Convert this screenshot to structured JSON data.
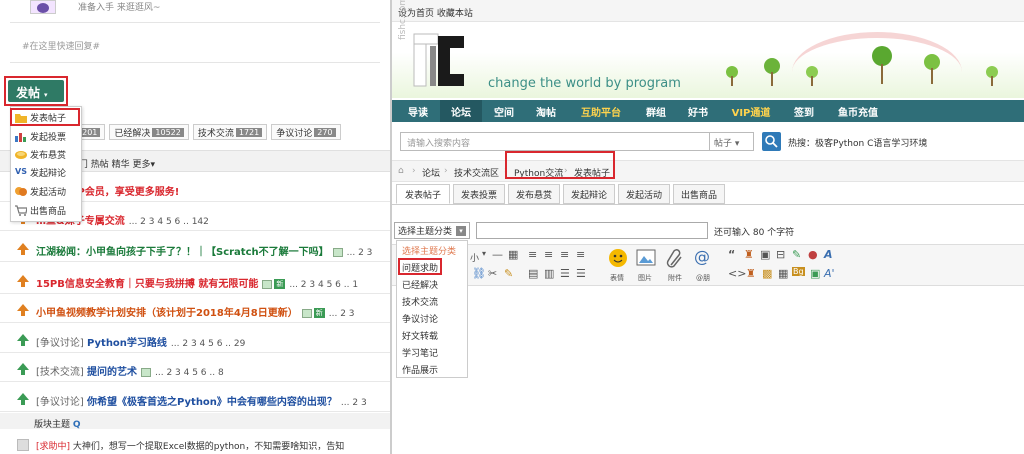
{
  "left": {
    "top_line": "准备入手 来逛逛风~",
    "quick_reply_placeholder": "#在这里快速回复#",
    "post_button": {
      "label": "发帖",
      "caret": "▾"
    },
    "dropdown": [
      {
        "label": "发表帖子",
        "icon": "folder-icon"
      },
      {
        "label": "发起投票",
        "icon": "poll-icon"
      },
      {
        "label": "发布悬赏",
        "icon": "reward-icon"
      },
      {
        "label": "发起辩论",
        "icon": "versus-icon"
      },
      {
        "label": "发起活动",
        "icon": "activity-icon"
      },
      {
        "label": "出售商品",
        "icon": "cart-icon"
      }
    ],
    "tabs": [
      {
        "label": "助",
        "count": "6201"
      },
      {
        "label": "已经解决",
        "count": "10522"
      },
      {
        "label": "技术交流",
        "count": "1721"
      },
      {
        "label": "争议讨论",
        "count": "270"
      }
    ],
    "filter_text": "新 热门 热帖 精华 更多▾",
    "threads": [
      {
        "category": "",
        "title": "入终身VIP会员，享受更多服务!",
        "pages": "",
        "style": "red",
        "img": false,
        "new": false
      },
      {
        "category": "",
        "title": "…鱼&妹子专属交流",
        "pages": "... 2 3 4 5 6 .. 142",
        "style": "red",
        "img": false,
        "new": false
      },
      {
        "category": "",
        "title": "江湖秘闻：小甲鱼向孩子下手了？！｜【Scratch不了解一下吗】",
        "pages": "... 2 3",
        "style": "green",
        "img": true,
        "new": false
      },
      {
        "category": "",
        "title": "15PB信息安全教育｜只要与我拼搏 就有无限可能",
        "pages": "... 2 3 4 5 6 .. 1",
        "style": "red",
        "img": true,
        "new": true
      },
      {
        "category": "",
        "title": "小甲鱼视频教学计划安排（该计划于2018年4月8日更新）",
        "pages": "... 2 3",
        "style": "orange",
        "img": true,
        "new": true
      },
      {
        "category": "[争议讨论]",
        "title": "Python学习路线",
        "pages": "... 2 3 4 5 6 .. 29",
        "style": "blue",
        "img": false,
        "new": false
      },
      {
        "category": "[技术交流]",
        "title": "提问的艺术",
        "pages": "... 2 3 4 5 6 .. 8",
        "style": "blue",
        "img": true,
        "new": false
      },
      {
        "category": "[争议讨论]",
        "title": "你希望《极客首选之Python》中会有哪些内容的出现？",
        "pages": "... 2 3",
        "style": "blue",
        "img": false,
        "new": false
      }
    ],
    "section_label": "版块主题",
    "last_row": {
      "tag": "[求助中]",
      "text": "大神们，想写一个提取Excel数据的python，不知需要啥知识，告知"
    }
  },
  "right": {
    "top_links": "设为首页  收藏本站",
    "slogan": "change the world by program",
    "logo_side_text": "fishc.com",
    "nav": [
      "导读",
      "论坛",
      "空间",
      "淘帖",
      "互助平台",
      "群组",
      "好书",
      "VIP通道",
      "签到",
      "鱼币充值"
    ],
    "search": {
      "placeholder": "请输入搜索内容",
      "select": "帖子 ▾"
    },
    "hot_label": "热搜：",
    "hot_items": "极客Python  C语言学习环境",
    "breadcrumb": [
      "论坛",
      "技术交流区",
      "Python交流",
      "发表帖子"
    ],
    "post_tabs": [
      "发表帖子",
      "发表投票",
      "发布悬赏",
      "发起辩论",
      "发起活动",
      "出售商品"
    ],
    "topic_select": "选择主题分类",
    "chars_left_text": "还可输入 80 个字符",
    "topic_options": [
      "选择主题分类",
      "问题求助",
      "已经解决",
      "技术交流",
      "争议讨论",
      "好文转载",
      "学习笔记",
      "作品展示"
    ],
    "editor_labels": {
      "small": "小",
      "emoji": "表情",
      "image": "图片",
      "attach": "附件",
      "at": "@朋"
    }
  },
  "colors": {
    "accent": "#2f7a65",
    "nav": "#2f6e78",
    "highlight": "#d9272e"
  }
}
